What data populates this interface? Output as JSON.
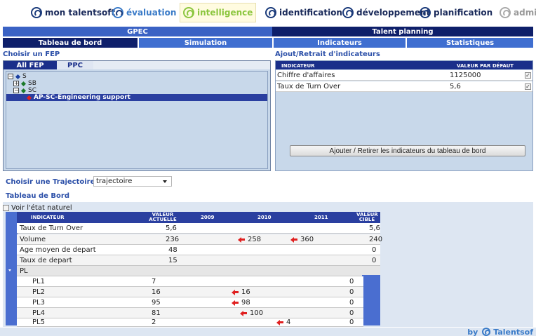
{
  "nav": {
    "items": [
      {
        "label": "mon talentsoft"
      },
      {
        "label": "évaluation"
      },
      {
        "label": "intelligence"
      },
      {
        "label": "identification"
      },
      {
        "label": "développement"
      },
      {
        "label": "planification"
      },
      {
        "label": "admi"
      }
    ]
  },
  "sections": {
    "gpec": "GPEC",
    "talent_planning": "Talent planning"
  },
  "tabs": {
    "tableau_de_bord": "Tableau de bord",
    "simulation": "Simulation",
    "indicateurs": "Indicateurs",
    "statistiques": "Statistiques"
  },
  "fep": {
    "title": "Choisir un FEP",
    "tabs": [
      "All FEP",
      "PPC"
    ],
    "tree": [
      {
        "toggle": "−",
        "label": "S",
        "color": "#1a3fa0"
      },
      {
        "toggle": "+",
        "label": "SB",
        "color": "#1a7a2a"
      },
      {
        "toggle": "−",
        "label": "SC",
        "color": "#1a7a2a"
      },
      {
        "toggle": "",
        "label": "AP-SC-Engineering support",
        "color": "#e02020"
      }
    ]
  },
  "indicators_panel": {
    "title": "Ajout/Retrait d'indicateurs",
    "col_indicateur": "INDICATEUR",
    "col_valeur": "VALEUR PAR DÉFAUT",
    "rows": [
      {
        "name": "Chiffre d'affaires",
        "value": "1125000",
        "checked": true
      },
      {
        "name": "Taux de Turn Over",
        "value": "5,6",
        "checked": true
      }
    ],
    "button": "Ajouter / Retirer les indicateurs du tableau de bord"
  },
  "trajectoire": {
    "label": "Choisir une Trajectoire:",
    "value": "trajectoire"
  },
  "tableau": {
    "title": "Tableau de Bord",
    "voir_label": "Voir l'état naturel",
    "headers": {
      "indicateur": "INDICATEUR",
      "valeur_actuelle_1": "VALEUR",
      "valeur_actuelle_2": "ACTUELLE",
      "y2009": "2009",
      "y2010": "2010",
      "y2011": "2011",
      "valeur_cible_1": "VALEUR",
      "valeur_cible_2": "CIBLE"
    },
    "rows": [
      {
        "name": "Taux de Turn Over",
        "actuelle": "5,6",
        "y2010": "",
        "y2011": "",
        "cible": "5,6"
      },
      {
        "name": "Volume",
        "actuelle": "236",
        "y2010": "258",
        "y2011": "360",
        "cible": "240"
      },
      {
        "name": "Age moyen de depart",
        "actuelle": "48",
        "y2010": "",
        "y2011": "",
        "cible": "0"
      },
      {
        "name": "Taux de depart",
        "actuelle": "15",
        "y2010": "",
        "y2011": "",
        "cible": "0"
      }
    ],
    "group": "PL",
    "sub_rows": [
      {
        "name": "PL1",
        "actuelle": "7",
        "y2009": "",
        "y2010": "",
        "y2011": "",
        "cible": "0"
      },
      {
        "name": "PL2",
        "actuelle": "16",
        "y2009": "16",
        "y2010": "",
        "y2011": "",
        "cible": "0"
      },
      {
        "name": "PL3",
        "actuelle": "95",
        "y2009": "98",
        "y2010": "",
        "y2011": "",
        "cible": "0"
      },
      {
        "name": "PL4",
        "actuelle": "81",
        "y2009": "",
        "y2010": "100",
        "y2011": "",
        "cible": "0"
      },
      {
        "name": "PL5",
        "actuelle": "2",
        "y2009": "",
        "y2010": "",
        "y2011": "4",
        "cible": "0"
      }
    ]
  },
  "footer": {
    "by": "by",
    "brand": "Talentsof"
  },
  "colors": {
    "nav_dark": "#0e1f6a",
    "nav_mid": "#3a62c4",
    "panel_bg": "#c8d8ea",
    "accent_red": "#e02020",
    "accent_green": "#8cc63f"
  }
}
